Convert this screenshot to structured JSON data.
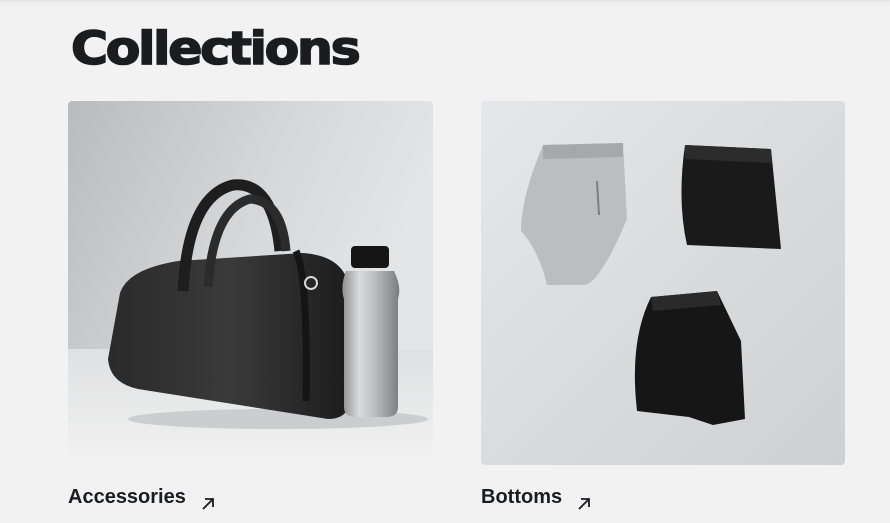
{
  "page": {
    "title": "Collections"
  },
  "collections": [
    {
      "label": "Accessories",
      "image": "gym-bag-and-water-bottle-photo",
      "icon": "arrow-up-right-icon"
    },
    {
      "label": "Bottoms",
      "image": "folded-shorts-flatlay-photo",
      "icon": "arrow-up-right-icon"
    }
  ],
  "colors": {
    "background": "#f2f2f2",
    "text": "#1b1c20"
  }
}
